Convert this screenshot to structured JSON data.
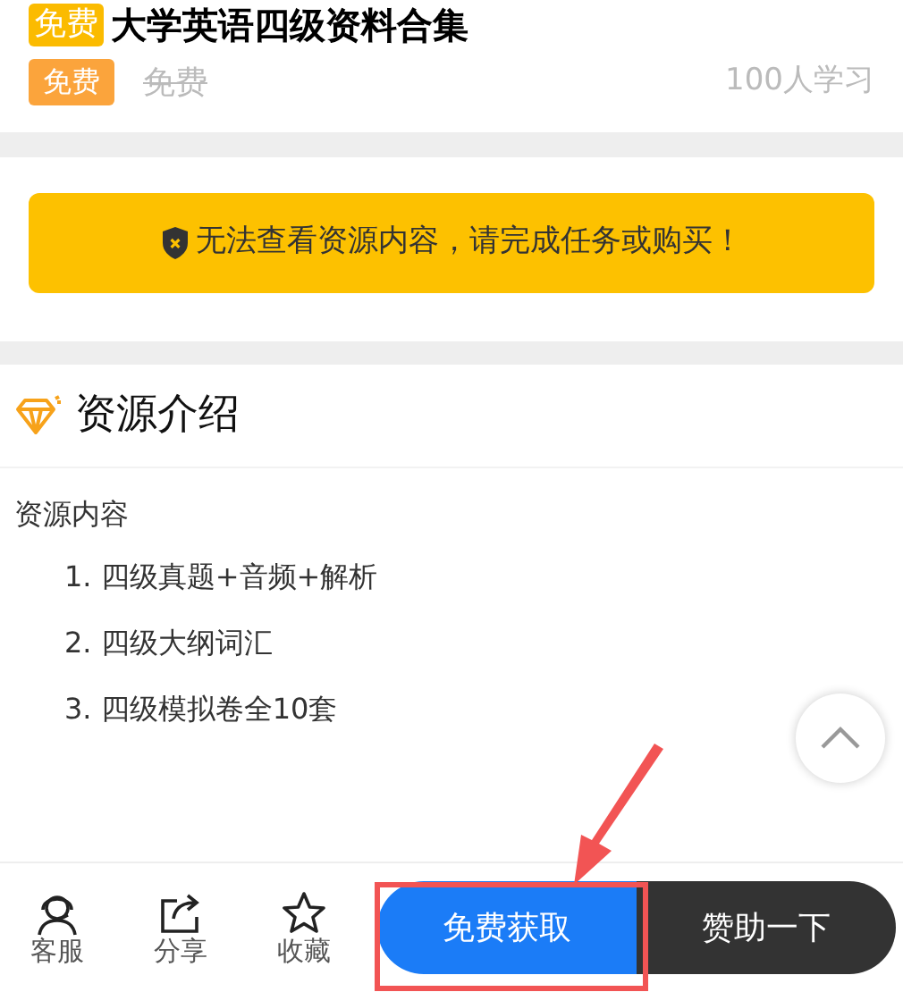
{
  "title": {
    "tag": "免费",
    "text": "大学英语四级资料合集"
  },
  "price": {
    "tag": "免费",
    "original": "免费",
    "learners": "100人学习"
  },
  "notice": {
    "text": "无法查看资源内容，请完成任务或购买！"
  },
  "section": {
    "heading": "资源介绍",
    "intro": "资源内容",
    "items": [
      "1. 四级真题+音频+解析",
      "2. 四级大纲词汇",
      "3. 四级模拟卷全10套"
    ]
  },
  "toolbar": [
    {
      "kind": "service",
      "label": "客服"
    },
    {
      "kind": "share",
      "label": "分享"
    },
    {
      "kind": "favorite",
      "label": "收藏"
    }
  ],
  "actions": [
    {
      "kind": "primary",
      "label": "免费获取"
    },
    {
      "kind": "dark",
      "label": "赞助一下"
    }
  ]
}
